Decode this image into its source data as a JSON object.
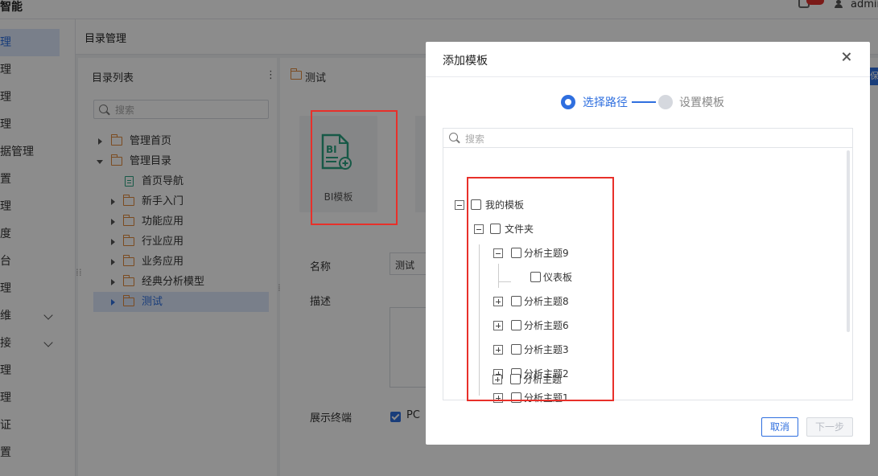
{
  "app": {
    "title": "智能",
    "user": "admin"
  },
  "sidebar": {
    "items": [
      {
        "label": "理",
        "active": true
      },
      {
        "label": "理"
      },
      {
        "label": "理"
      },
      {
        "label": "理"
      },
      {
        "label": "据管理"
      },
      {
        "label": "置"
      },
      {
        "label": "理"
      },
      {
        "label": "度"
      },
      {
        "label": "台"
      },
      {
        "label": "理"
      },
      {
        "label": "维",
        "chevron": true
      },
      {
        "label": "接",
        "chevron": true
      },
      {
        "label": "理"
      },
      {
        "label": "理"
      },
      {
        "label": "证"
      },
      {
        "label": "置"
      }
    ]
  },
  "page": {
    "title": "目录管理"
  },
  "dir_panel": {
    "title": "目录列表",
    "more": "⋮",
    "search_placeholder": "搜索",
    "tree": [
      {
        "label": "管理首页",
        "icon": "folder-icon",
        "level": 0,
        "expand": "collapsed"
      },
      {
        "label": "管理目录",
        "icon": "folder-icon",
        "level": 0,
        "expand": "expanded"
      },
      {
        "label": "首页导航",
        "icon": "doc-icon",
        "level": 1,
        "expand": "none"
      },
      {
        "label": "新手入门",
        "icon": "folder-icon",
        "level": 1,
        "expand": "collapsed"
      },
      {
        "label": "功能应用",
        "icon": "folder-icon",
        "level": 1,
        "expand": "collapsed"
      },
      {
        "label": "行业应用",
        "icon": "folder-icon",
        "level": 1,
        "expand": "collapsed"
      },
      {
        "label": "业务应用",
        "icon": "folder-icon",
        "level": 1,
        "expand": "collapsed"
      },
      {
        "label": "经典分析模型",
        "icon": "folder-icon",
        "level": 1,
        "expand": "collapsed"
      },
      {
        "label": "测试",
        "icon": "folder-icon",
        "level": 1,
        "expand": "collapsed",
        "selected": true
      }
    ]
  },
  "content": {
    "breadcrumb": "测试",
    "template_card_label": "BI模板",
    "form": {
      "name_label": "名称",
      "name_value": "测试",
      "desc_label": "描述",
      "terminal_label": "展示终端",
      "pc_label": "PC"
    }
  },
  "modal": {
    "title": "添加模板",
    "steps": [
      {
        "label": "选择路径",
        "active": true
      },
      {
        "label": "设置模板",
        "active": false
      }
    ],
    "search_placeholder": "搜索",
    "tree": [
      {
        "label": "我的模板",
        "expand": "expanded"
      },
      {
        "label": "文件夹",
        "expand": "expanded"
      },
      {
        "label": "分析主题9",
        "expand": "expanded"
      },
      {
        "label": "仪表板",
        "expand": "none"
      },
      {
        "label": "分析主题8",
        "expand": "collapsed"
      },
      {
        "label": "分析主题6",
        "expand": "collapsed"
      },
      {
        "label": "分析主题3",
        "expand": "collapsed"
      },
      {
        "label": "分析主题2",
        "expand": "collapsed"
      },
      {
        "label": "分析主题1",
        "expand": "collapsed"
      },
      {
        "label": "分析主题",
        "expand": "collapsed"
      }
    ],
    "cancel_label": "取消",
    "next_label": "下一步"
  },
  "colors": {
    "accent": "#2f6fdf",
    "highlight": "#e8302a",
    "folder": "#e0893b",
    "doc": "#2ba381"
  }
}
